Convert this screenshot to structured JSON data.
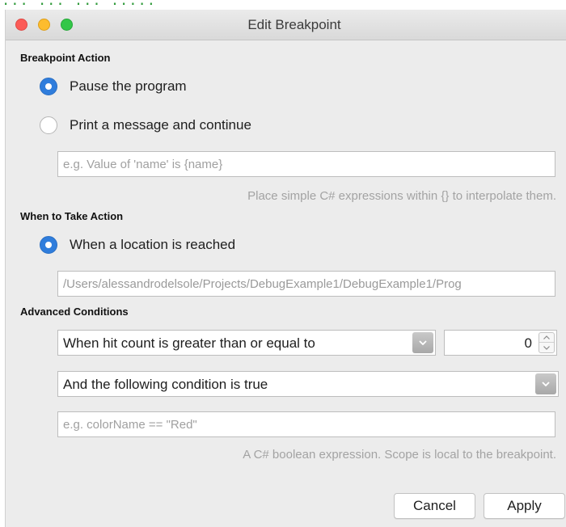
{
  "background": {
    "partial_text": "... ... ... ....."
  },
  "window": {
    "title": "Edit Breakpoint"
  },
  "sections": {
    "action": {
      "title": "Breakpoint Action",
      "options": [
        {
          "label": "Pause the program",
          "selected": true
        },
        {
          "label": "Print a message and continue",
          "selected": false
        }
      ],
      "message_placeholder": "e.g. Value of 'name' is {name}",
      "message_hint": "Place simple C# expressions within {} to interpolate them."
    },
    "when": {
      "title": "When to Take Action",
      "option": {
        "label": "When a location is reached",
        "selected": true
      },
      "location_value": "/Users/alessandrodelsole/Projects/DebugExample1/DebugExample1/Prog"
    },
    "advanced": {
      "title": "Advanced Conditions",
      "hit_count_mode": "When hit count is greater than or equal to",
      "hit_count_value": "0",
      "condition_mode": "And the following condition is true",
      "condition_placeholder": "e.g. colorName == \"Red\"",
      "condition_hint": "A C# boolean expression. Scope is local to the breakpoint."
    }
  },
  "buttons": {
    "cancel": "Cancel",
    "apply": "Apply"
  },
  "colors": {
    "accent": "#2f7ddc",
    "close": "#fc5b57",
    "minimize": "#fdbc2e",
    "zoom": "#33c748"
  }
}
